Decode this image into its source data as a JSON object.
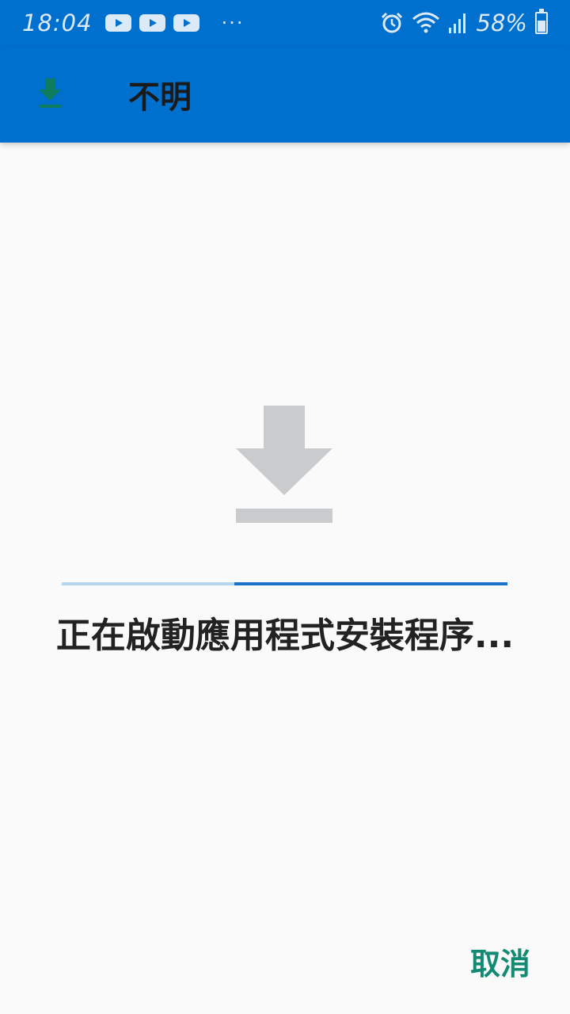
{
  "status_bar": {
    "time": "18:04",
    "notification_icons": [
      "youtube-icon",
      "youtube-icon",
      "youtube-icon"
    ],
    "overflow": "···",
    "system_icons": [
      "alarm-icon",
      "wifi-icon",
      "signal-icon"
    ],
    "battery": "58%"
  },
  "app_bar": {
    "icon": "download-icon",
    "title": "不明"
  },
  "main": {
    "icon": "download-icon",
    "progress_state": "indeterminate",
    "message": "正在啟動應用程式安裝程序..."
  },
  "actions": {
    "cancel_label": "取消"
  },
  "colors": {
    "primary": "#0070ce",
    "background": "#fafafa",
    "progress_track": "#b5d6ee",
    "progress_fill": "#1a73c8",
    "accent": "#138a72",
    "icon_gray": "#c9cbcd"
  }
}
